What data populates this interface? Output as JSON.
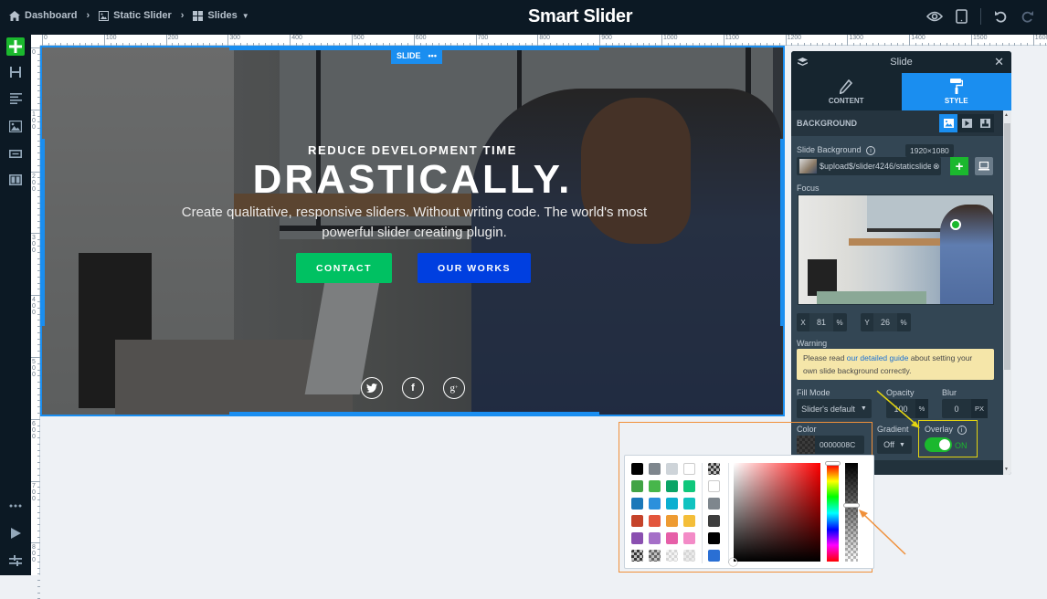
{
  "topbar": {
    "breadcrumbs": [
      {
        "label": "Dashboard",
        "icon": "home-icon"
      },
      {
        "label": "Static Slider",
        "icon": "image-icon"
      },
      {
        "label": "Slides",
        "icon": "grid-icon"
      }
    ],
    "logo": "Smart Slider",
    "actions": [
      "eye-icon",
      "tablet-icon",
      "undo-icon",
      "redo-icon"
    ]
  },
  "leftbar": {
    "items": [
      "add-icon",
      "heading-icon",
      "text-icon",
      "image-icon",
      "button-icon",
      "columns-icon"
    ],
    "bottom": [
      "more-icon",
      "play-icon",
      "settings-icon"
    ]
  },
  "ruler": {
    "h_labels": [
      "0",
      "100",
      "200",
      "300",
      "400",
      "500",
      "600",
      "700",
      "800",
      "900",
      "1000",
      "1100",
      "1200",
      "1300",
      "1400",
      "1500",
      "1600"
    ],
    "v_labels": [
      "0",
      "100",
      "200",
      "300",
      "400",
      "500",
      "600",
      "700",
      "800"
    ]
  },
  "slide": {
    "label": "SLIDE",
    "subtitle": "REDUCE DEVELOPMENT TIME",
    "title": "DRASTICALLY.",
    "description": "Create qualitative, responsive sliders. Without writing code. The world's most powerful slider creating plugin.",
    "buttons": [
      {
        "label": "CONTACT",
        "color": "#00c162"
      },
      {
        "label": "OUR WORKS",
        "color": "#003fe0"
      }
    ],
    "social": [
      "twitter-icon",
      "facebook-icon",
      "google-plus-icon"
    ]
  },
  "panel": {
    "title": "Slide",
    "tabs": [
      {
        "label": "CONTENT"
      },
      {
        "label": "STYLE",
        "active": true
      }
    ],
    "section": "BACKGROUND",
    "slide_background_label": "Slide Background",
    "image_size": "1920×1080",
    "image_path": "$upload$/slider4246/staticslide",
    "focus_label": "Focus",
    "focus_x": "81",
    "focus_y": "26",
    "x_label": "X",
    "y_label": "Y",
    "percent": "%",
    "warning_label": "Warning",
    "warning_pre": "Please read ",
    "warning_link": "our detailed guide",
    "warning_post": " about setting your own slide background correctly.",
    "fill_mode_label": "Fill Mode",
    "fill_mode_value": "Slider's default",
    "opacity_label": "Opacity",
    "opacity_value": "100",
    "blur_label": "Blur",
    "blur_value": "0",
    "blur_unit": "PX",
    "color_label": "Color",
    "color_value": "0000008C",
    "gradient_label": "Gradient",
    "gradient_value": "Off",
    "overlay_label": "Overlay",
    "overlay_state": "ON"
  },
  "color_picker": {
    "swatches": [
      [
        "#000000",
        "#7e868d",
        "#ced4d9",
        "#ffffff"
      ],
      [
        "#41a345",
        "#47b64b",
        "#0ba467",
        "#0fc77c"
      ],
      [
        "#1a78b9",
        "#2b90dc",
        "#0bafd0",
        "#10c3c0"
      ],
      [
        "#c5432a",
        "#e3563d",
        "#ee9b32",
        "#f4be39"
      ],
      [
        "#8a4fb0",
        "#a56fc8",
        "#e65fa8",
        "#f38bc7"
      ]
    ],
    "recent": [
      "checker-dark",
      "#ffffff",
      "#7e868d",
      "#3d3d3d",
      "#000000",
      "#2a6fd4"
    ]
  }
}
